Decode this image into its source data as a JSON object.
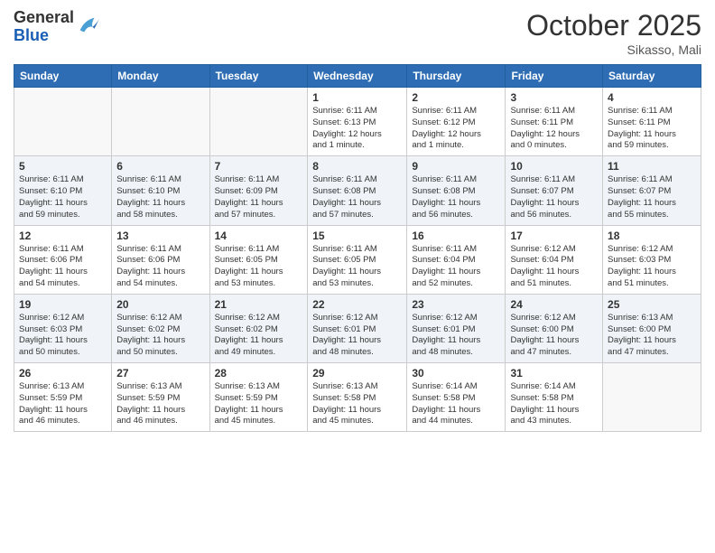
{
  "header": {
    "logo": {
      "general": "General",
      "blue": "Blue"
    },
    "title": "October 2025",
    "subtitle": "Sikasso, Mali"
  },
  "weekdays": [
    "Sunday",
    "Monday",
    "Tuesday",
    "Wednesday",
    "Thursday",
    "Friday",
    "Saturday"
  ],
  "weeks": [
    [
      {
        "day": "",
        "info": ""
      },
      {
        "day": "",
        "info": ""
      },
      {
        "day": "",
        "info": ""
      },
      {
        "day": "1",
        "info": "Sunrise: 6:11 AM\nSunset: 6:13 PM\nDaylight: 12 hours\nand 1 minute."
      },
      {
        "day": "2",
        "info": "Sunrise: 6:11 AM\nSunset: 6:12 PM\nDaylight: 12 hours\nand 1 minute."
      },
      {
        "day": "3",
        "info": "Sunrise: 6:11 AM\nSunset: 6:11 PM\nDaylight: 12 hours\nand 0 minutes."
      },
      {
        "day": "4",
        "info": "Sunrise: 6:11 AM\nSunset: 6:11 PM\nDaylight: 11 hours\nand 59 minutes."
      }
    ],
    [
      {
        "day": "5",
        "info": "Sunrise: 6:11 AM\nSunset: 6:10 PM\nDaylight: 11 hours\nand 59 minutes."
      },
      {
        "day": "6",
        "info": "Sunrise: 6:11 AM\nSunset: 6:10 PM\nDaylight: 11 hours\nand 58 minutes."
      },
      {
        "day": "7",
        "info": "Sunrise: 6:11 AM\nSunset: 6:09 PM\nDaylight: 11 hours\nand 57 minutes."
      },
      {
        "day": "8",
        "info": "Sunrise: 6:11 AM\nSunset: 6:08 PM\nDaylight: 11 hours\nand 57 minutes."
      },
      {
        "day": "9",
        "info": "Sunrise: 6:11 AM\nSunset: 6:08 PM\nDaylight: 11 hours\nand 56 minutes."
      },
      {
        "day": "10",
        "info": "Sunrise: 6:11 AM\nSunset: 6:07 PM\nDaylight: 11 hours\nand 56 minutes."
      },
      {
        "day": "11",
        "info": "Sunrise: 6:11 AM\nSunset: 6:07 PM\nDaylight: 11 hours\nand 55 minutes."
      }
    ],
    [
      {
        "day": "12",
        "info": "Sunrise: 6:11 AM\nSunset: 6:06 PM\nDaylight: 11 hours\nand 54 minutes."
      },
      {
        "day": "13",
        "info": "Sunrise: 6:11 AM\nSunset: 6:06 PM\nDaylight: 11 hours\nand 54 minutes."
      },
      {
        "day": "14",
        "info": "Sunrise: 6:11 AM\nSunset: 6:05 PM\nDaylight: 11 hours\nand 53 minutes."
      },
      {
        "day": "15",
        "info": "Sunrise: 6:11 AM\nSunset: 6:05 PM\nDaylight: 11 hours\nand 53 minutes."
      },
      {
        "day": "16",
        "info": "Sunrise: 6:11 AM\nSunset: 6:04 PM\nDaylight: 11 hours\nand 52 minutes."
      },
      {
        "day": "17",
        "info": "Sunrise: 6:12 AM\nSunset: 6:04 PM\nDaylight: 11 hours\nand 51 minutes."
      },
      {
        "day": "18",
        "info": "Sunrise: 6:12 AM\nSunset: 6:03 PM\nDaylight: 11 hours\nand 51 minutes."
      }
    ],
    [
      {
        "day": "19",
        "info": "Sunrise: 6:12 AM\nSunset: 6:03 PM\nDaylight: 11 hours\nand 50 minutes."
      },
      {
        "day": "20",
        "info": "Sunrise: 6:12 AM\nSunset: 6:02 PM\nDaylight: 11 hours\nand 50 minutes."
      },
      {
        "day": "21",
        "info": "Sunrise: 6:12 AM\nSunset: 6:02 PM\nDaylight: 11 hours\nand 49 minutes."
      },
      {
        "day": "22",
        "info": "Sunrise: 6:12 AM\nSunset: 6:01 PM\nDaylight: 11 hours\nand 48 minutes."
      },
      {
        "day": "23",
        "info": "Sunrise: 6:12 AM\nSunset: 6:01 PM\nDaylight: 11 hours\nand 48 minutes."
      },
      {
        "day": "24",
        "info": "Sunrise: 6:12 AM\nSunset: 6:00 PM\nDaylight: 11 hours\nand 47 minutes."
      },
      {
        "day": "25",
        "info": "Sunrise: 6:13 AM\nSunset: 6:00 PM\nDaylight: 11 hours\nand 47 minutes."
      }
    ],
    [
      {
        "day": "26",
        "info": "Sunrise: 6:13 AM\nSunset: 5:59 PM\nDaylight: 11 hours\nand 46 minutes."
      },
      {
        "day": "27",
        "info": "Sunrise: 6:13 AM\nSunset: 5:59 PM\nDaylight: 11 hours\nand 46 minutes."
      },
      {
        "day": "28",
        "info": "Sunrise: 6:13 AM\nSunset: 5:59 PM\nDaylight: 11 hours\nand 45 minutes."
      },
      {
        "day": "29",
        "info": "Sunrise: 6:13 AM\nSunset: 5:58 PM\nDaylight: 11 hours\nand 45 minutes."
      },
      {
        "day": "30",
        "info": "Sunrise: 6:14 AM\nSunset: 5:58 PM\nDaylight: 11 hours\nand 44 minutes."
      },
      {
        "day": "31",
        "info": "Sunrise: 6:14 AM\nSunset: 5:58 PM\nDaylight: 11 hours\nand 43 minutes."
      },
      {
        "day": "",
        "info": ""
      }
    ]
  ]
}
